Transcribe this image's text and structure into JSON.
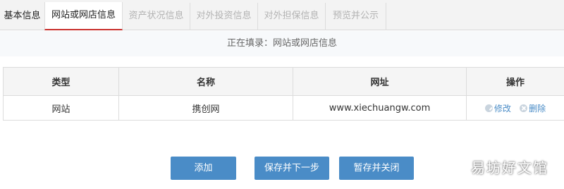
{
  "tabs": [
    {
      "label": "基本信息",
      "state": "done"
    },
    {
      "label": "网站或网店信息",
      "state": "active"
    },
    {
      "label": "资产状况信息",
      "state": "pending"
    },
    {
      "label": "对外投资信息",
      "state": "pending"
    },
    {
      "label": "对外担保信息",
      "state": "pending"
    },
    {
      "label": "预览并公示",
      "state": "pending"
    }
  ],
  "subheader": "正在填录：网站或网店信息",
  "table": {
    "headers": [
      "类型",
      "名称",
      "网址",
      "操作"
    ],
    "rows": [
      {
        "type": "网站",
        "name": "携创网",
        "url": "www.xiechuangw.com",
        "edit": "修改",
        "delete": "删除"
      }
    ]
  },
  "buttons": {
    "add": "添加",
    "save_next": "保存并下一步",
    "save_close": "暂存并关闭"
  },
  "watermark": "易坊好文馆",
  "colors": {
    "accent": "#4a8cc7",
    "active_tab_border": "#c9302c"
  }
}
